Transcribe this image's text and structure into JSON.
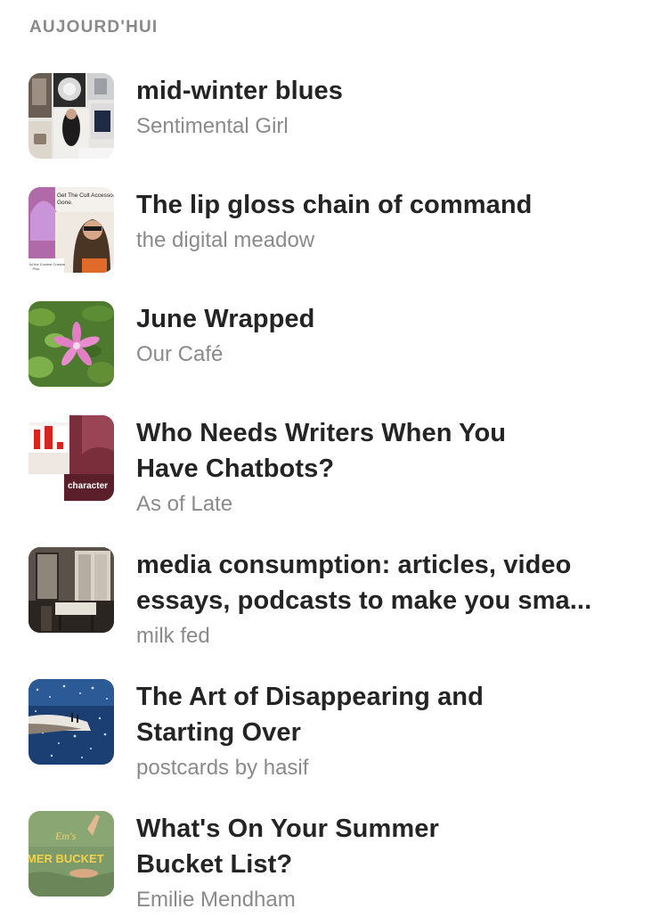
{
  "section": {
    "header": "AUJOURD'HUI"
  },
  "items": [
    {
      "title": "mid-winter blues",
      "author": "Sentimental Girl",
      "thumbnail": "moodboard-collage-thumbnail"
    },
    {
      "title": "The lip gloss chain of command",
      "author": "the digital meadow",
      "thumbnail": "accessory-collage-thumbnail",
      "thumb_text": "Get The Cult Accessory Be Gone."
    },
    {
      "title": "June Wrapped",
      "author": "Our Café",
      "thumbnail": "pink-flower-thumbnail"
    },
    {
      "title": "Who Needs Writers When You\nHave Chatbots?",
      "author": "As of Late",
      "thumbnail": "chart-screenshot-thumbnail",
      "thumb_text": "character"
    },
    {
      "title": "media consumption: articles, video\nessays, podcasts to make you sma...",
      "author": "milk fed",
      "thumbnail": "vintage-room-thumbnail"
    },
    {
      "title": "The Art of Disappearing and\nStarting Over",
      "author": "postcards by hasif",
      "thumbnail": "sparkling-sea-thumbnail"
    },
    {
      "title": "What's On Your Summer\nBucket List?",
      "author": "Emilie Mendham",
      "thumbnail": "summer-bucket-thumbnail",
      "thumb_text_top": "Em's",
      "thumb_text": "MER BUCKET"
    }
  ],
  "colors": {
    "title": "#242424",
    "secondary": "#8a8a8a",
    "background": "#ffffff"
  }
}
